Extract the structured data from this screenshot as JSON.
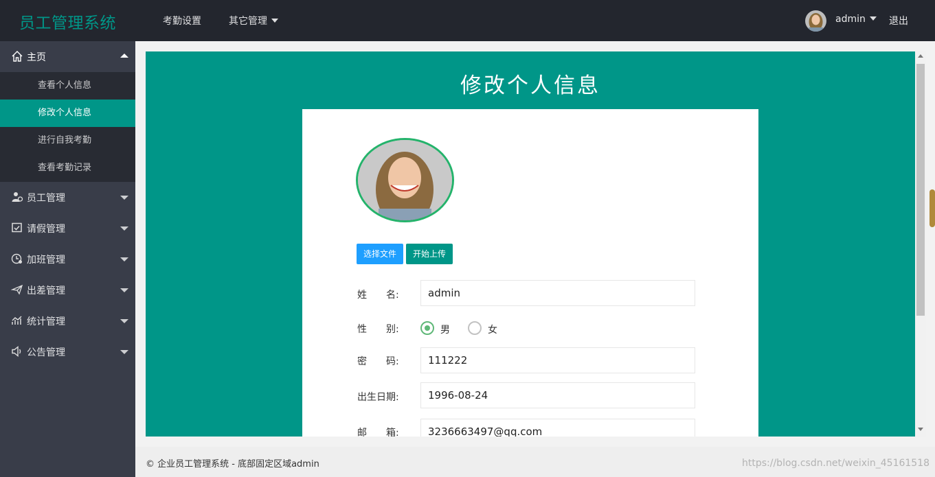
{
  "header": {
    "logo": "员工管理系统",
    "nav": [
      {
        "label": "考勤设置"
      },
      {
        "label": "其它管理"
      }
    ],
    "user_name": "admin",
    "logout": "退出"
  },
  "sidebar": {
    "home": {
      "label": "主页",
      "subitems": [
        {
          "label": "查看个人信息"
        },
        {
          "label": "修改个人信息"
        },
        {
          "label": "进行自我考勤"
        },
        {
          "label": "查看考勤记录"
        }
      ]
    },
    "items": [
      {
        "label": "员工管理",
        "icon": "user-icon"
      },
      {
        "label": "请假管理",
        "icon": "calendar-check-icon"
      },
      {
        "label": "加班管理",
        "icon": "clock-icon"
      },
      {
        "label": "出差管理",
        "icon": "plane-icon"
      },
      {
        "label": "统计管理",
        "icon": "chart-icon"
      },
      {
        "label": "公告管理",
        "icon": "speaker-icon"
      }
    ]
  },
  "main": {
    "title": "修改个人信息",
    "buttons": {
      "choose": "选择文件",
      "upload": "开始上传"
    },
    "form": {
      "name_label": "姓　　名:",
      "name_value": "admin",
      "gender_label": "性　　别:",
      "gender_male": "男",
      "gender_female": "女",
      "gender_selected": "男",
      "password_label": "密　　码:",
      "password_value": "111222",
      "birth_label": "出生日期:",
      "birth_value": "1996-08-24",
      "email_label": "邮　　箱:",
      "email_value": "3236663497@qq.com"
    }
  },
  "footer": {
    "text": "© 企业员工管理系统 - 底部固定区域admin",
    "watermark": "https://blog.csdn.net/weixin_45161518"
  },
  "colors": {
    "accent": "#009688",
    "header_bg": "#23262e",
    "sidebar_bg": "#393d49",
    "blue_button": "#1e9fff"
  }
}
